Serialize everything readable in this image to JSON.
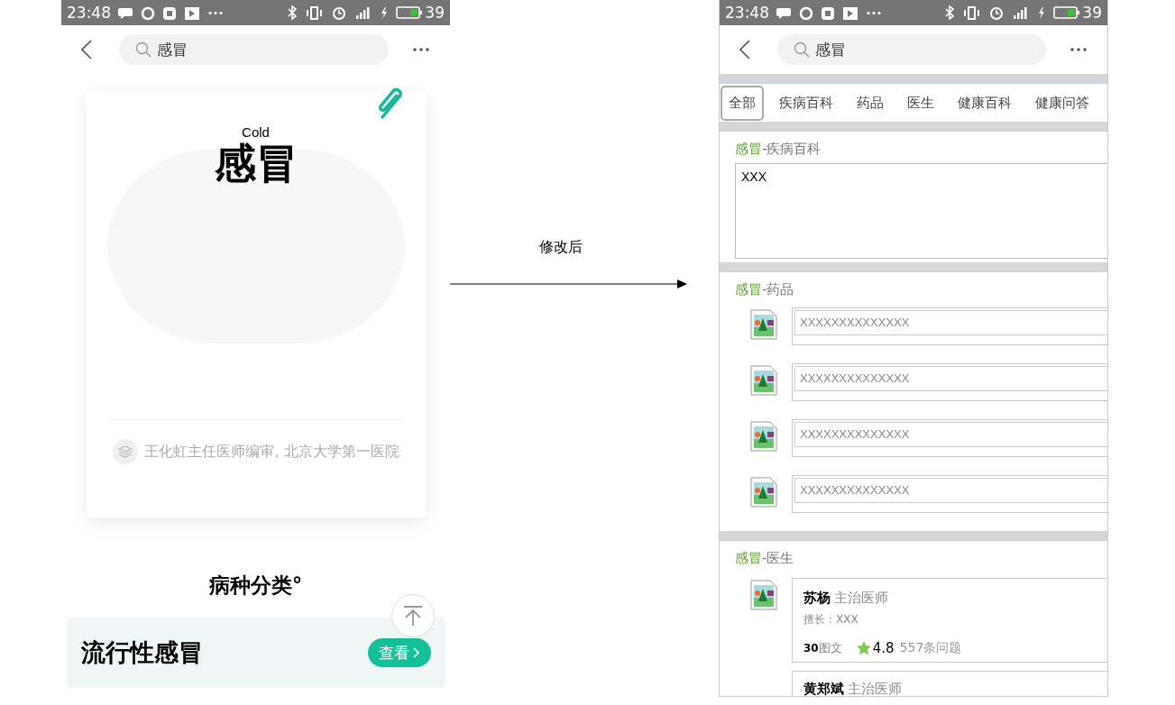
{
  "before": {
    "status_bar": {
      "time": "23:48",
      "battery": "39"
    },
    "search": {
      "value": "感冒"
    },
    "card": {
      "subtitle": "Cold",
      "title": "感冒",
      "author": "王化虹主任医师编审, 北京大学第一医院"
    },
    "section_title": "病种分类°",
    "category": {
      "title": "流行性感冒",
      "button": "查看"
    }
  },
  "transition": {
    "label": "修改后"
  },
  "after": {
    "status_bar": {
      "time": "23:48",
      "battery": "39"
    },
    "search": {
      "value": "感冒"
    },
    "tabs": [
      {
        "label": "全部",
        "selected": true
      },
      {
        "label": "疾病百科",
        "selected": false
      },
      {
        "label": "药品",
        "selected": false
      },
      {
        "label": "医生",
        "selected": false
      },
      {
        "label": "健康百科",
        "selected": false
      },
      {
        "label": "健康问答",
        "selected": false
      }
    ],
    "sections": [
      {
        "kind": "text",
        "keyword": "感冒",
        "heading": "-疾病百科",
        "body": "XXX"
      },
      {
        "kind": "drugs",
        "keyword": "感冒",
        "heading": "-药品",
        "items": [
          {
            "name": "XXXXXXXXXXXXXX"
          },
          {
            "name": "XXXXXXXXXXXXXX"
          },
          {
            "name": "XXXXXXXXXXXXXX"
          },
          {
            "name": "XXXXXXXXXXXXXX"
          }
        ]
      },
      {
        "kind": "doctors",
        "keyword": "感冒",
        "heading": "-医生",
        "doctors": [
          {
            "name": "苏杨",
            "title": "主治医师",
            "specialty": "擅长：XXX",
            "articles_count": "30",
            "articles_label": "图文",
            "rating": "4.8",
            "questions": "557条问题"
          },
          {
            "name": "黄郑斌",
            "title": "主治医师"
          }
        ]
      }
    ]
  }
}
